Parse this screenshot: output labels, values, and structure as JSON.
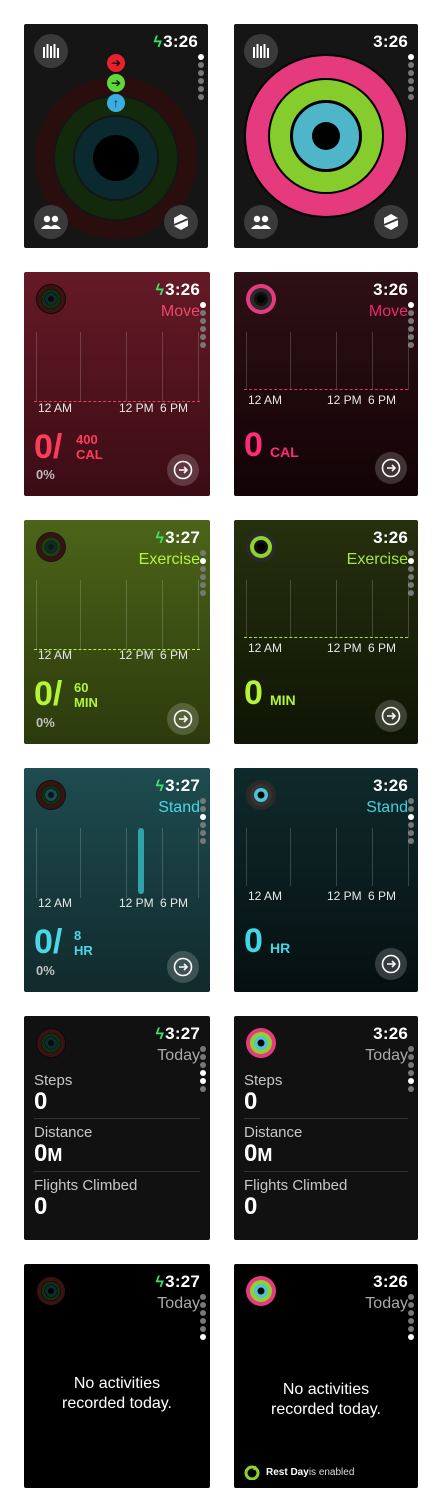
{
  "screens": {
    "rings_off": {
      "time": "3:26"
    },
    "rings_on": {
      "time": "3:26"
    },
    "move_off": {
      "time": "3:26",
      "title": "Move",
      "value": "0/",
      "goal_num": "400",
      "goal_unit": "CAL",
      "percent": "0%",
      "ax1": "12 AM",
      "ax2": "12 PM",
      "ax3": "6 PM"
    },
    "move_on": {
      "time": "3:26",
      "title": "Move",
      "value": "0",
      "unit": "CAL",
      "ax1": "12 AM",
      "ax2": "12 PM",
      "ax3": "6 PM"
    },
    "ex_off": {
      "time": "3:27",
      "title": "Exercise",
      "value": "0/",
      "goal_num": "60",
      "goal_unit": "MIN",
      "percent": "0%",
      "ax1": "12 AM",
      "ax2": "12 PM",
      "ax3": "6 PM"
    },
    "ex_on": {
      "time": "3:26",
      "title": "Exercise",
      "value": "0",
      "unit": "MIN",
      "ax1": "12 AM",
      "ax2": "12 PM",
      "ax3": "6 PM"
    },
    "st_off": {
      "time": "3:27",
      "title": "Stand",
      "value": "0/",
      "goal_num": "8",
      "goal_unit": "HR",
      "percent": "0%",
      "ax1": "12 AM",
      "ax2": "12 PM",
      "ax3": "6 PM"
    },
    "st_on": {
      "time": "3:26",
      "title": "Stand",
      "value": "0",
      "unit": "HR",
      "ax1": "12 AM",
      "ax2": "12 PM",
      "ax3": "6 PM"
    },
    "today_off": {
      "time": "3:27",
      "title": "Today",
      "steps_label": "Steps",
      "steps": "0",
      "distance_label": "Distance",
      "distance": "0",
      "distance_unit": "M",
      "flights_label": "Flights Climbed",
      "flights": "0"
    },
    "today_on": {
      "time": "3:26",
      "title": "Today",
      "steps_label": "Steps",
      "steps": "0",
      "distance_label": "Distance",
      "distance": "0",
      "distance_unit": "M",
      "flights_label": "Flights Climbed",
      "flights": "0"
    },
    "act_off": {
      "time": "3:27",
      "title": "Today",
      "message1": "No activities",
      "message2": "recorded today."
    },
    "act_on": {
      "time": "3:26",
      "title": "Today",
      "message1": "No activities",
      "message2": "recorded today.",
      "rest_bold": "Rest Day",
      "rest_rest": " is enabled"
    }
  },
  "colors": {
    "move": "#ff2d55",
    "move_dim": "#f0476a",
    "exercise": "#a6ff00",
    "stand": "#40d8e6"
  },
  "icons": [
    "chart-icon",
    "friends-icon",
    "awards-icon",
    "arrow-right-icon",
    "arrow-up-icon",
    "summary-arrow-icon",
    "lightning-bolt-icon",
    "rest-day-icon"
  ]
}
